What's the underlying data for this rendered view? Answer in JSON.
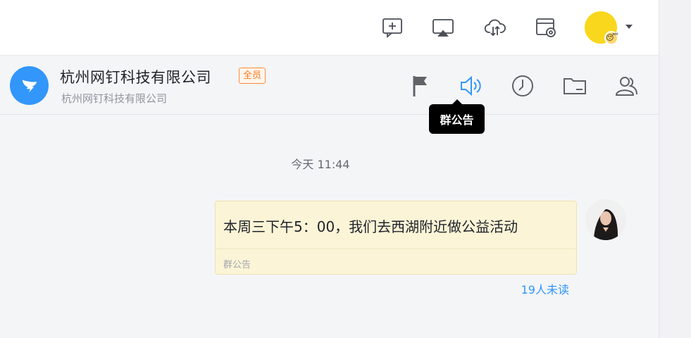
{
  "toolbar": {
    "icons": [
      "new-chat-icon",
      "screen-share-icon",
      "cloud-sync-icon",
      "calendar-settings-icon"
    ],
    "user_avatar_color": "#f9d71c"
  },
  "chat_header": {
    "group_name": "杭州网钉科技有限公司",
    "member_tag": "全员",
    "subtitle": "杭州网钉科技有限公司",
    "avatar_color": "#3296fa",
    "actions": [
      "flag-icon",
      "announcement-icon",
      "history-icon",
      "folder-icon",
      "members-icon"
    ],
    "tooltip": "群公告"
  },
  "messages": {
    "timestamp": "今天 11:44",
    "notice": {
      "text": "本周三下午5：00，我们去西湖附近做公益活动",
      "label": "群公告"
    },
    "unread": "19人未读"
  },
  "colors": {
    "accent": "#3296fa",
    "notice_bg": "#fbf4d6",
    "tag_orange": "#ff7a1a"
  }
}
